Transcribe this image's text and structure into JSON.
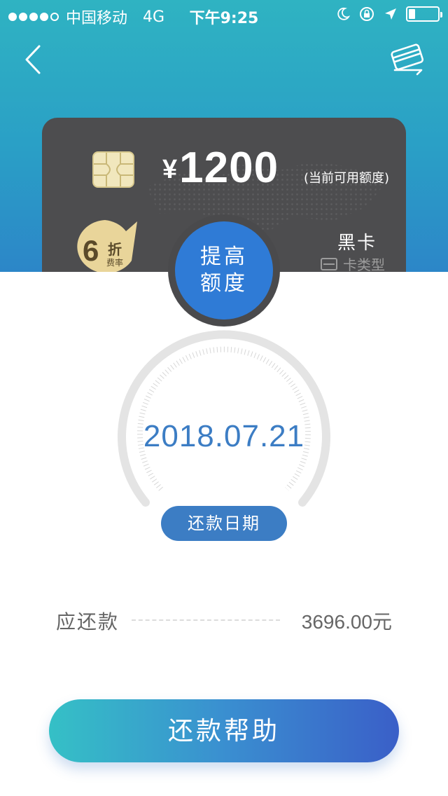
{
  "status_bar": {
    "carrier": "中国移动",
    "network": "4G",
    "time": "下午9:25"
  },
  "nav": {
    "back_icon": "chevron-left-icon",
    "card_icon": "card-switch-icon"
  },
  "card": {
    "currency": "¥",
    "amount": "1200",
    "amount_note": "(当前可用额度)",
    "discount_number": "6",
    "discount_unit": "折",
    "discount_sub": "费率",
    "type_name": "黑卡",
    "type_label": "卡类型"
  },
  "raise": {
    "line1": "提高",
    "line2": "额度"
  },
  "repayment": {
    "date": "2018.07.21",
    "date_label": "还款日期",
    "due_label": "应还款",
    "due_value": "3696.00元"
  },
  "help_button": {
    "label": "还款帮助"
  },
  "colors": {
    "header_top": "#2fb3c2",
    "header_bottom": "#2c86c8",
    "card_bg": "#4d4d4f",
    "accent_blue": "#3c7dc4",
    "raise_blue": "#2f7bd6",
    "help_start": "#35c0c6",
    "help_end": "#3a5fc8"
  }
}
